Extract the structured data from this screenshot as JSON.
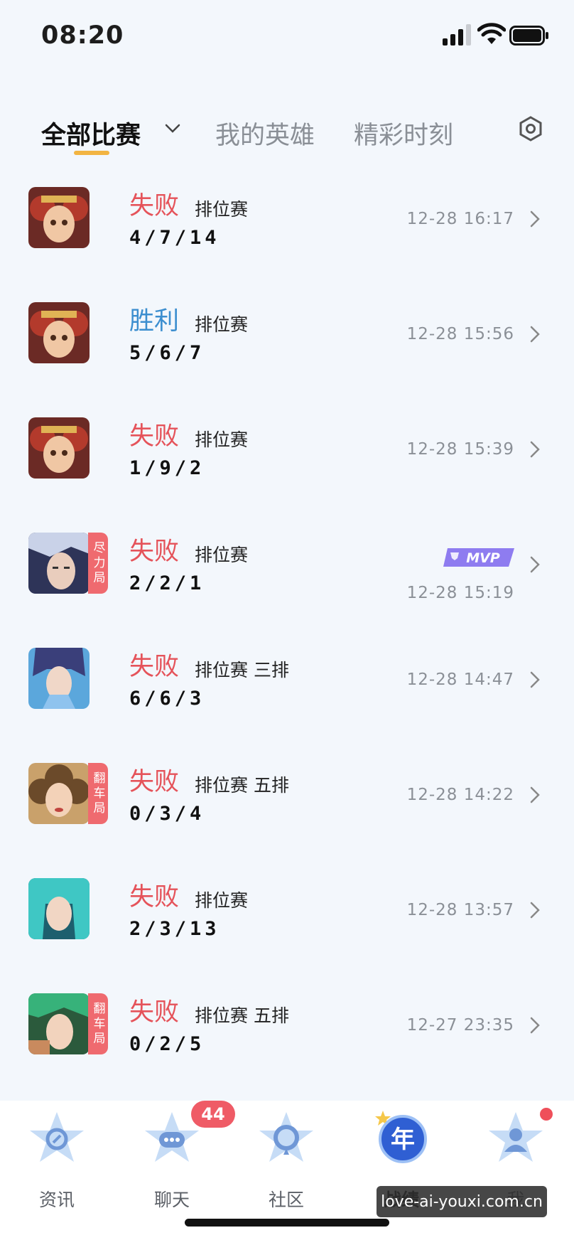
{
  "status_bar": {
    "time": "08:20"
  },
  "tabs": [
    {
      "label": "全部比赛",
      "active": true
    },
    {
      "label": "我的英雄",
      "active": false
    },
    {
      "label": "精彩时刻",
      "active": false
    }
  ],
  "matches": [
    {
      "result": "失败",
      "result_type": "lose",
      "mode": "排位赛",
      "kda": "4/7/14",
      "time": "12-28 16:17",
      "tag": "",
      "mvp": "",
      "hero_icon": "hero-red-hair-avatar"
    },
    {
      "result": "胜利",
      "result_type": "win",
      "mode": "排位赛",
      "kda": "5/6/7",
      "time": "12-28 15:56",
      "tag": "",
      "mvp": "",
      "hero_icon": "hero-red-hair-avatar"
    },
    {
      "result": "失败",
      "result_type": "lose",
      "mode": "排位赛",
      "kda": "1/9/2",
      "time": "12-28 15:39",
      "tag": "",
      "mvp": "",
      "hero_icon": "hero-red-hair-avatar"
    },
    {
      "result": "失败",
      "result_type": "lose",
      "mode": "排位赛",
      "kda": "2/2/1",
      "time": "12-28 15:19",
      "tag": "尽力局",
      "mvp": "MVP",
      "hero_icon": "hero-silver-hair-avatar"
    },
    {
      "result": "失败",
      "result_type": "lose",
      "mode": "排位赛 三排",
      "kda": "6/6/3",
      "time": "12-28 14:47",
      "tag": "",
      "mvp": "",
      "hero_icon": "hero-blue-robe-avatar"
    },
    {
      "result": "失败",
      "result_type": "lose",
      "mode": "排位赛 五排",
      "kda": "0/3/4",
      "time": "12-28 14:22",
      "tag": "翻车局",
      "mvp": "",
      "hero_icon": "hero-curly-hair-avatar"
    },
    {
      "result": "失败",
      "result_type": "lose",
      "mode": "排位赛",
      "kda": "2/3/13",
      "time": "12-28 13:57",
      "tag": "",
      "mvp": "",
      "hero_icon": "hero-teal-hair-avatar"
    },
    {
      "result": "失败",
      "result_type": "lose",
      "mode": "排位赛 五排",
      "kda": "0/2/5",
      "time": "12-27 23:35",
      "tag": "翻车局",
      "mvp": "",
      "hero_icon": "hero-green-hair-avatar"
    }
  ],
  "bottom_nav": [
    {
      "label": "资讯",
      "icon": "news-icon",
      "active": false
    },
    {
      "label": "聊天",
      "icon": "chat-icon",
      "active": false,
      "badge": "44"
    },
    {
      "label": "社区",
      "icon": "community-icon",
      "active": false
    },
    {
      "label": "战绩",
      "icon": "new-year-record-icon",
      "active": true,
      "icon_text": "年"
    },
    {
      "label": "我",
      "icon": "profile-icon",
      "active": false
    }
  ],
  "watermark": "love-ai-youxi.com.cn",
  "colors": {
    "lose": "#e5535a",
    "win": "#3c8ecf",
    "accent_underline": "#f2b442",
    "tag_bg": "#ef6a6f",
    "mvp": "#8e7cf0"
  }
}
